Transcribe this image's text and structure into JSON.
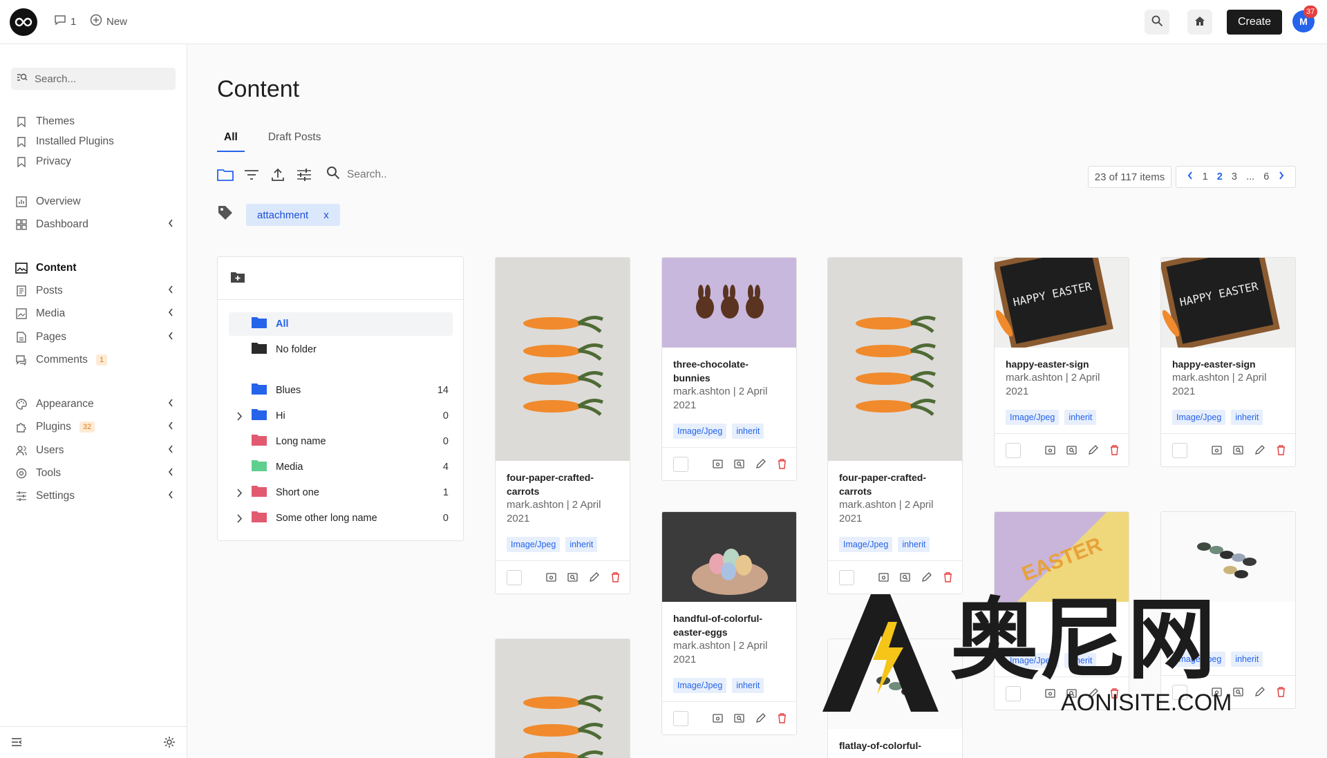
{
  "topbar": {
    "comments_count": "1",
    "new_label": "New",
    "create_label": "Create",
    "avatar_initial": "M",
    "avatar_badge": "37"
  },
  "sidebar": {
    "search_placeholder": "Search...",
    "group1": [
      "Themes",
      "Installed Plugins",
      "Privacy"
    ],
    "overview": "Overview",
    "dashboard": "Dashboard",
    "content": "Content",
    "posts": "Posts",
    "media": "Media",
    "pages": "Pages",
    "comments": "Comments",
    "comments_badge": "1",
    "appearance": "Appearance",
    "plugins": "Plugins",
    "plugins_badge": "32",
    "users": "Users",
    "tools": "Tools",
    "settings": "Settings"
  },
  "main": {
    "title": "Content",
    "tabs": [
      "All",
      "Draft Posts"
    ],
    "search_placeholder": "Search..",
    "item_count": "23 of 117 items",
    "pages": [
      "1",
      "2",
      "3",
      "...",
      "6"
    ],
    "filter_chip": "attachment",
    "filter_chip_remove": "x"
  },
  "folders": [
    {
      "name": "All",
      "count": "",
      "color": "#2563eb"
    },
    {
      "name": "No folder",
      "count": "",
      "color": "#2b2b2b"
    },
    {
      "name": "Blues",
      "count": "14",
      "color": "#2563eb"
    },
    {
      "name": "Hi",
      "count": "0",
      "color": "#2563eb"
    },
    {
      "name": "Long name",
      "count": "0",
      "color": "#e25a6f"
    },
    {
      "name": "Media",
      "count": "4",
      "color": "#5fcf8e"
    },
    {
      "name": "Short one",
      "count": "1",
      "color": "#e25a6f"
    },
    {
      "name": "Some other long name",
      "count": "0",
      "color": "#e25a6f"
    }
  ],
  "cards": [
    {
      "title": "four-paper-crafted-carrots",
      "meta": "mark.ashton | 2 April 2021",
      "type": "Image/Jpeg",
      "visibility": "inherit"
    },
    {
      "title": "three-chocolate-bunnies",
      "meta": "mark.ashton | 2 April 2021",
      "type": "Image/Jpeg",
      "visibility": "inherit"
    },
    {
      "title": "four-paper-crafted-carrots",
      "meta": "mark.ashton | 2 April 2021",
      "type": "Image/Jpeg",
      "visibility": "inherit"
    },
    {
      "title": "happy-easter-sign",
      "meta": "mark.ashton | 2 April 2021",
      "type": "Image/Jpeg",
      "visibility": "inherit"
    },
    {
      "title": "happy-easter-sign",
      "meta": "mark.ashton | 2 April 2021",
      "type": "Image/Jpeg",
      "visibility": "inherit"
    },
    {
      "title": "handful-of-colorful-easter-eggs",
      "meta": "mark.ashton | 2 April 2021",
      "type": "Image/Jpeg",
      "visibility": "inherit"
    },
    {
      "title": "",
      "meta": "",
      "type": "Image/Jpeg",
      "visibility": "inherit"
    },
    {
      "title": "",
      "meta": "",
      "type": "Image/Jpeg",
      "visibility": "inherit"
    },
    {
      "title": "flatlay-of-colorful-",
      "meta": "",
      "type": "",
      "visibility": ""
    }
  ],
  "thumb_text": {
    "easter_sign": "HAPPY EASTER",
    "easter_split": "EASTER"
  },
  "watermark": {
    "brand": "奥尼网",
    "site": "AONISITE.COM"
  }
}
